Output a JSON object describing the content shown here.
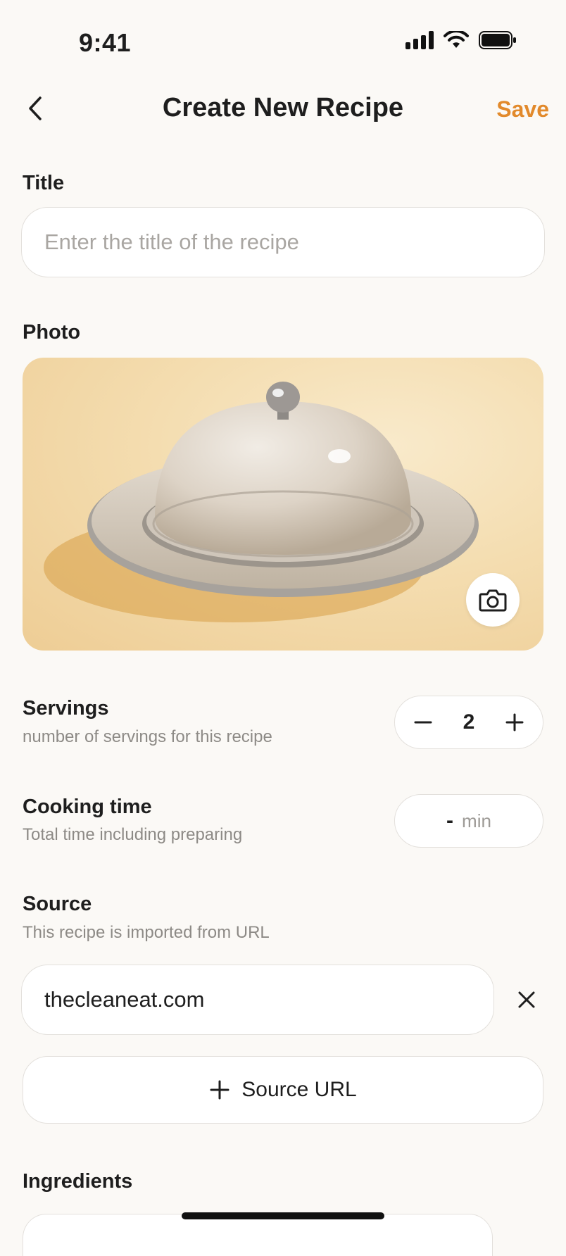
{
  "status_bar": {
    "time": "9:41"
  },
  "header": {
    "title": "Create New Recipe",
    "save_label": "Save"
  },
  "title_field": {
    "label": "Title",
    "placeholder": "Enter the title of the recipe",
    "value": ""
  },
  "photo": {
    "label": "Photo"
  },
  "servings": {
    "label": "Servings",
    "description": "number of servings for this recipe",
    "value": "2"
  },
  "cooking_time": {
    "label": "Cooking time",
    "description": "Total time including preparing",
    "value": "-",
    "unit": "min"
  },
  "source": {
    "label": "Source",
    "description": "This recipe is imported from URL",
    "value": "thecleaneat.com",
    "add_label": "Source URL"
  },
  "ingredients": {
    "label": "Ingredients"
  },
  "colors": {
    "accent": "#E28A2C",
    "background": "#FBF9F6",
    "border": "#E3E0DC"
  }
}
